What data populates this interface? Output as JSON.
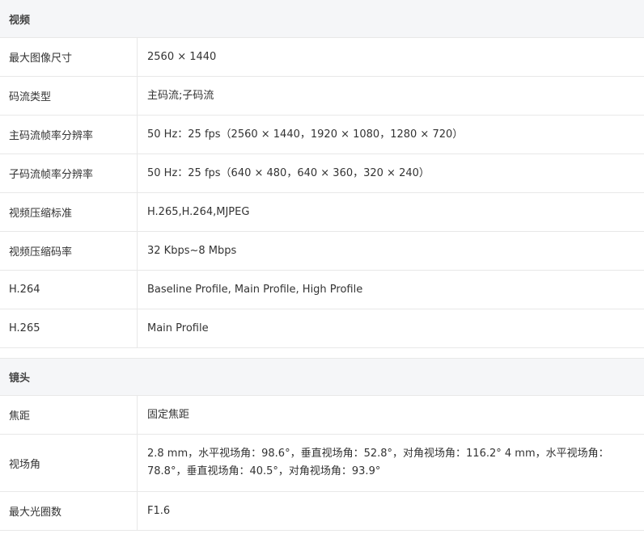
{
  "sections": [
    {
      "title": "视频",
      "rows": [
        {
          "label": "最大图像尺寸",
          "value": "2560 × 1440"
        },
        {
          "label": "码流类型",
          "value": "主码流;子码流"
        },
        {
          "label": "主码流帧率分辨率",
          "value": "50 Hz：25 fps（2560 × 1440，1920 × 1080，1280 × 720）"
        },
        {
          "label": "子码流帧率分辨率",
          "value": "50 Hz：25 fps（640 × 480，640 × 360，320 × 240）"
        },
        {
          "label": "视频压缩标准",
          "value": "H.265,H.264,MJPEG"
        },
        {
          "label": "视频压缩码率",
          "value": "32 Kbps~8 Mbps"
        },
        {
          "label": "H.264",
          "value": "Baseline Profile, Main Profile, High Profile"
        },
        {
          "label": "H.265",
          "value": "Main Profile"
        }
      ]
    },
    {
      "title": "镜头",
      "rows": [
        {
          "label": "焦距",
          "value": "固定焦距"
        },
        {
          "label": "视场角",
          "value": "2.8 mm，水平视场角：98.6°，垂直视场角：52.8°，对角视场角：116.2° 4 mm，水平视场角：78.8°，垂直视场角：40.5°，对角视场角：93.9°"
        },
        {
          "label": "最大光圈数",
          "value": "F1.6"
        }
      ]
    }
  ]
}
